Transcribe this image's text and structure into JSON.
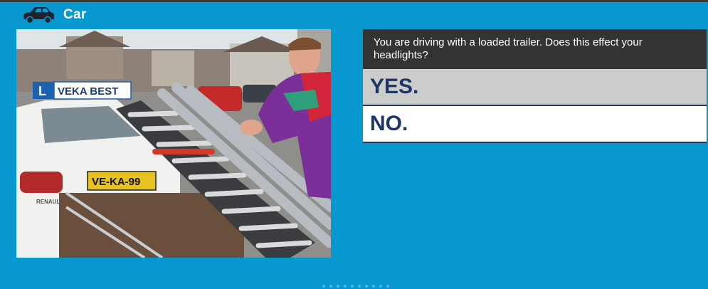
{
  "header": {
    "icon": "car-icon",
    "title": "Car"
  },
  "photo": {
    "description_icon": "question-photo",
    "sign_letter": "L",
    "sign_text": "VEKA BEST",
    "plate_text": "VE-KA-99",
    "badge_text": "RENAULT"
  },
  "question": {
    "text": "You are driving with a loaded trailer. Does this effect your headlights?"
  },
  "answers": [
    {
      "label": "YES."
    },
    {
      "label": "NO."
    }
  ],
  "colors": {
    "background": "#0798cf",
    "question_bg": "#333333",
    "answer_text": "#1f3564",
    "answer_selected_bg": "#cccccc"
  }
}
